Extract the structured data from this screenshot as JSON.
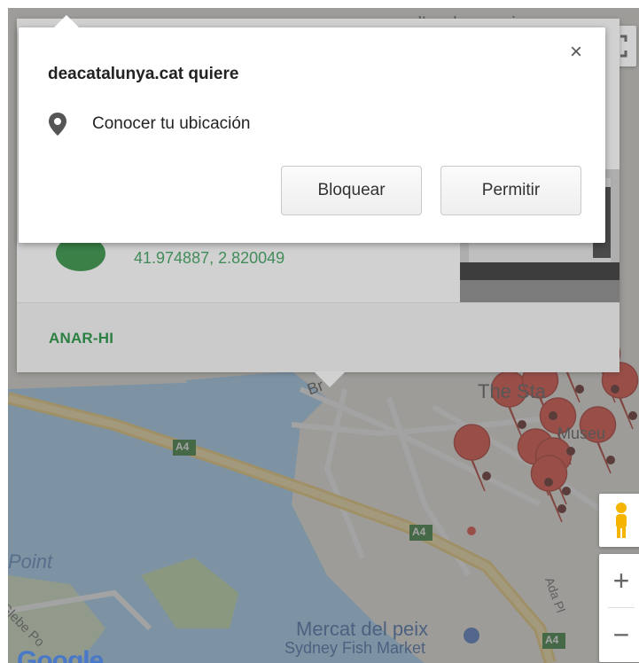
{
  "map": {
    "labels": {
      "top_place": "d'embarcacions",
      "the_star": "The Sta",
      "museu": "Museu",
      "point": "Point",
      "glebe": "Glebe Po",
      "mercat": "Mercat del peix",
      "fish_market": "Sydney Fish Market",
      "road_a4_1": "A4",
      "road_a4_2": "A4",
      "road_a4_3": "A4",
      "ada": "Ada Pl",
      "google": "Google",
      "street_br": "Br"
    },
    "colors": {
      "water": "#aadaff",
      "land": "#f2efe9",
      "park": "#c8e6b0",
      "road": "#fde293",
      "marker": "#e94335"
    }
  },
  "info_window": {
    "coords": "41.974887, 2.820049",
    "action": "ANAR-HI"
  },
  "permission_popup": {
    "title": "deacatalunya.cat quiere",
    "permission_icon": "location-pin-icon",
    "permission_label": "Conocer tu ubicación",
    "close_label": "×",
    "block_label": "Bloquear",
    "allow_label": "Permitir"
  },
  "controls": {
    "zoom_in": "+",
    "zoom_out": "−",
    "pegman_icon": "pegman-icon",
    "fullscreen_icon": "fullscreen-icon"
  }
}
